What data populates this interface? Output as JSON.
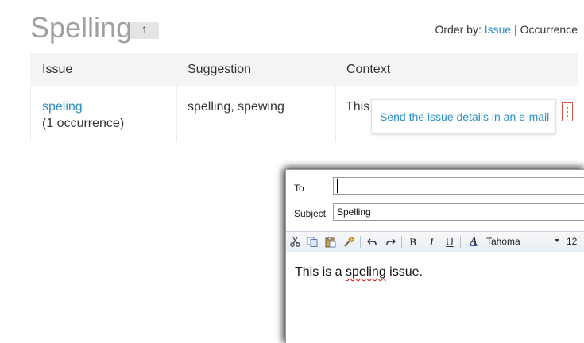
{
  "header": {
    "title": "Spelling",
    "count": "1"
  },
  "order_by": {
    "label": "Order by:",
    "issue": "Issue",
    "separator": "|",
    "occurrence": "Occurrence"
  },
  "table": {
    "columns": [
      "Issue",
      "Suggestion",
      "Context"
    ],
    "rows": [
      {
        "issue": "speling",
        "occurrences": "(1 occurrence)",
        "suggestion": "spelling, spewing",
        "context": "This"
      }
    ]
  },
  "popup": {
    "send_email": "Send the issue details in an e-mail"
  },
  "email": {
    "to_label": "To",
    "to_value": "",
    "subject_label": "Subject",
    "subject_value": "Spelling",
    "toolbar": {
      "icons": [
        "cut-icon",
        "copy-icon",
        "paste-icon",
        "format-painter-icon",
        "undo-icon",
        "redo-icon",
        "bold-icon",
        "italic-icon",
        "underline-icon",
        "font-color-icon"
      ],
      "bold": "B",
      "italic": "I",
      "underline": "U",
      "font_color": "A",
      "font": "Tahoma",
      "size": "12"
    },
    "body_before": "This is a ",
    "body_misspelled": "speling",
    "body_after": " issue."
  },
  "colors": {
    "link": "#2b8fc6",
    "title": "#a0a0a0",
    "menu_border": "#d9534f",
    "squiggle": "#dd0000"
  }
}
